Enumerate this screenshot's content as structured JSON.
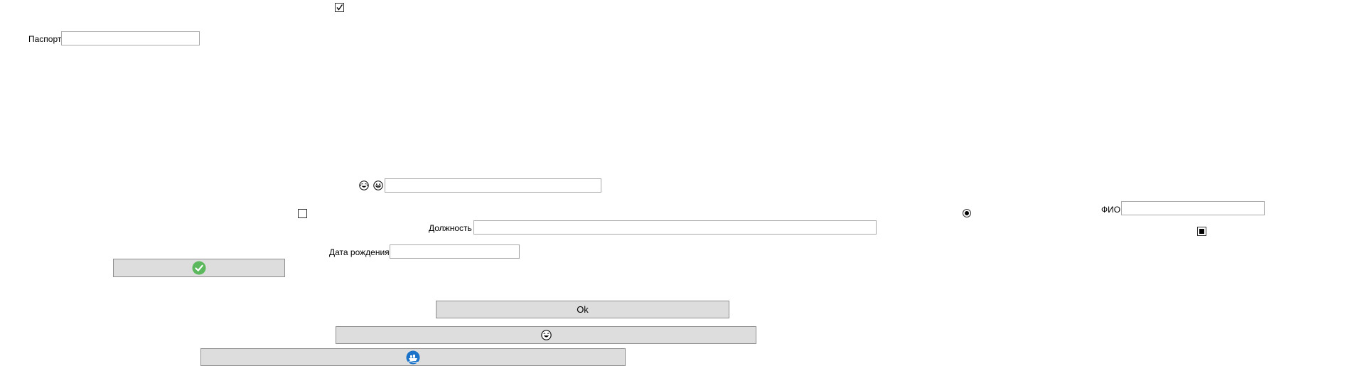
{
  "form": {
    "passport_label": "Паспорт",
    "passport_value": "",
    "fio_label": "ФИО",
    "fio_value": "",
    "position_label": "Должность",
    "position_value": "",
    "birthdate_label": "Дата рождения",
    "birthdate_value": "",
    "emoji_field_value": ""
  },
  "controls": {
    "top_checkbox_checked": true,
    "left_checkbox_checked": false,
    "radio_selected": true,
    "right_checkbox_state": "indeterminate"
  },
  "buttons": {
    "ok_label": "Ok",
    "check_button_icon": "check-circle-icon",
    "emoji_button_icon": "grinning-face-icon",
    "ship_button_icon": "ship-badge-icon"
  },
  "icons": {
    "emoji_left": "crying-laughing-face-icon",
    "emoji_right": "grinning-face-icon"
  },
  "colors": {
    "button_bg": "#dddddd",
    "button_border": "#8e8e8e",
    "field_border": "#a9a9a9",
    "check_green": "#5cb85c",
    "ship_blue": "#1a73c8"
  }
}
